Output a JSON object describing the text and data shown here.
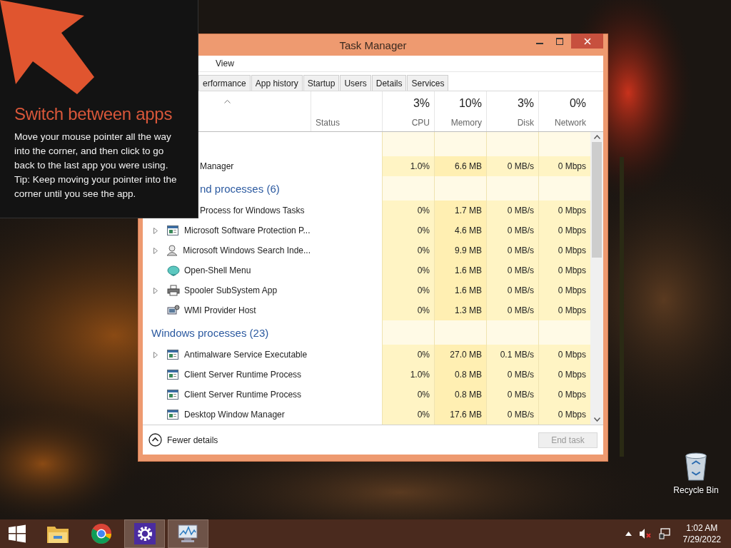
{
  "desktop": {
    "icons": [
      {
        "kind": "recycle-bin",
        "label": "Recycle Bin"
      }
    ]
  },
  "tip": {
    "title": "Switch between apps",
    "paragraphs": [
      "Move your mouse pointer all the way into the corner, and then click to go back to the last app you were using.",
      "Tip: Keep moving your pointer into the corner until you see the app."
    ]
  },
  "window": {
    "title": "Task Manager",
    "menu": [
      "View"
    ],
    "tabs": [
      {
        "label": "erformance",
        "selected": false
      },
      {
        "label": "App history",
        "selected": false
      },
      {
        "label": "Startup",
        "selected": false
      },
      {
        "label": "Users",
        "selected": false
      },
      {
        "label": "Details",
        "selected": false
      },
      {
        "label": "Services",
        "selected": false
      }
    ],
    "columns": [
      {
        "kind": "text",
        "label": "Status"
      },
      {
        "kind": "meter",
        "usage": "3%",
        "label": "CPU"
      },
      {
        "kind": "meter",
        "usage": "10%",
        "label": "Memory"
      },
      {
        "kind": "meter",
        "usage": "3%",
        "label": "Disk"
      },
      {
        "kind": "meter",
        "usage": "0%",
        "label": "Network"
      }
    ],
    "groups": [
      {
        "rows": [
          {
            "name": "Manager",
            "values": [
              "1.0%",
              "6.6 MB",
              "0 MB/s",
              "0 Mbps"
            ]
          }
        ]
      },
      {
        "title": "nd processes (6)",
        "rows": [
          {
            "name": "Process for Windows Tasks",
            "values": [
              "0%",
              "1.7 MB",
              "0 MB/s",
              "0 Mbps"
            ]
          },
          {
            "name": "Microsoft Software Protection P...",
            "kind": "window",
            "expandable": true,
            "values": [
              "0%",
              "4.6 MB",
              "0 MB/s",
              "0 Mbps"
            ]
          },
          {
            "name": "Microsoft Windows Search Inde...",
            "kind": "search",
            "expandable": true,
            "values": [
              "0%",
              "9.9 MB",
              "0 MB/s",
              "0 Mbps"
            ]
          },
          {
            "name": "Open-Shell Menu",
            "kind": "shell",
            "expandable": false,
            "values": [
              "0%",
              "1.6 MB",
              "0 MB/s",
              "0 Mbps"
            ]
          },
          {
            "name": "Spooler SubSystem App",
            "kind": "printer",
            "expandable": true,
            "values": [
              "0%",
              "1.6 MB",
              "0 MB/s",
              "0 Mbps"
            ]
          },
          {
            "name": "WMI Provider Host",
            "kind": "computer",
            "expandable": false,
            "values": [
              "0%",
              "1.3 MB",
              "0 MB/s",
              "0 Mbps"
            ]
          }
        ]
      },
      {
        "title": "Windows processes (23)",
        "rows": [
          {
            "name": "Antimalware Service Executable",
            "kind": "window",
            "expandable": true,
            "values": [
              "0%",
              "27.0 MB",
              "0.1 MB/s",
              "0 Mbps"
            ]
          },
          {
            "name": "Client Server Runtime Process",
            "kind": "window",
            "expandable": false,
            "values": [
              "1.0%",
              "0.8 MB",
              "0 MB/s",
              "0 Mbps"
            ]
          },
          {
            "name": "Client Server Runtime Process",
            "kind": "window",
            "expandable": false,
            "values": [
              "0%",
              "0.8 MB",
              "0 MB/s",
              "0 Mbps"
            ]
          },
          {
            "name": "Desktop Window Manager",
            "kind": "window",
            "expandable": false,
            "values": [
              "0%",
              "17.6 MB",
              "0 MB/s",
              "0 Mbps"
            ]
          }
        ]
      }
    ],
    "fewer_details": "Fewer details",
    "end_task": {
      "label": "End task",
      "disabled": true
    }
  },
  "taskbar": {
    "apps": [
      {
        "kind": "folder",
        "active": false
      },
      {
        "kind": "browser",
        "active": false
      },
      {
        "kind": "gear",
        "active": true
      },
      {
        "kind": "monitor",
        "active": true
      }
    ],
    "time": "1:02 AM",
    "date": "7/29/2022"
  }
}
